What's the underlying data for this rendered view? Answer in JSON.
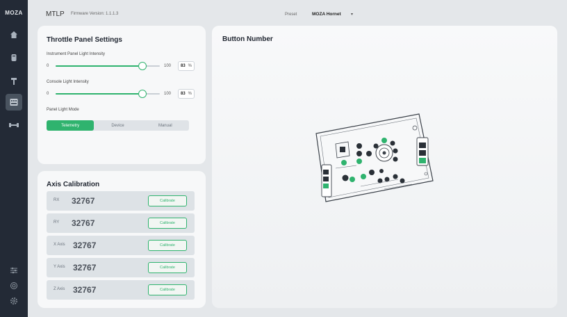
{
  "sidebar": {
    "logo": "MOZA",
    "items": [
      {
        "icon": "home-icon"
      },
      {
        "icon": "wheelbase-icon"
      },
      {
        "icon": "pedal-icon"
      },
      {
        "icon": "throttle-panel-icon",
        "active": true
      },
      {
        "icon": "usb-connector-icon"
      },
      {
        "icon": "sliders-icon"
      },
      {
        "icon": "support-icon"
      },
      {
        "icon": "settings-icon"
      }
    ]
  },
  "header": {
    "app_title": "MTLP",
    "firmware": "Firmware Version: 1.1.1.3",
    "preset_label": "Preset",
    "preset_value": "MOZA Hornet",
    "preset_caret": "▾"
  },
  "throttle": {
    "title": "Throttle Panel Settings",
    "instrument": {
      "label": "Instrument Panel Light Intensity",
      "min": "0",
      "max": "100",
      "value": "83",
      "unit": "%",
      "level": 83
    },
    "console": {
      "label": "Console Light Intensity",
      "min": "0",
      "max": "100",
      "value": "83",
      "unit": "%",
      "level": 83
    },
    "mode": {
      "label": "Panel Light Mode",
      "options": [
        "Telemetry",
        "Device",
        "Manual"
      ],
      "selected": "Telemetry"
    }
  },
  "axis": {
    "title": "Axis Calibration",
    "button_label": "Calibrate",
    "rows": [
      {
        "name": "RX",
        "value": "32767"
      },
      {
        "name": "RY",
        "value": "32767"
      },
      {
        "name": "X Axis",
        "value": "32767"
      },
      {
        "name": "Y Axis",
        "value": "32767"
      },
      {
        "name": "Z Axis",
        "value": "32767"
      }
    ]
  },
  "button_panel": {
    "title": "Button Number"
  },
  "colors": {
    "accent": "#2fb36e",
    "sidebar": "#232a36",
    "background": "#e4e7ea"
  }
}
